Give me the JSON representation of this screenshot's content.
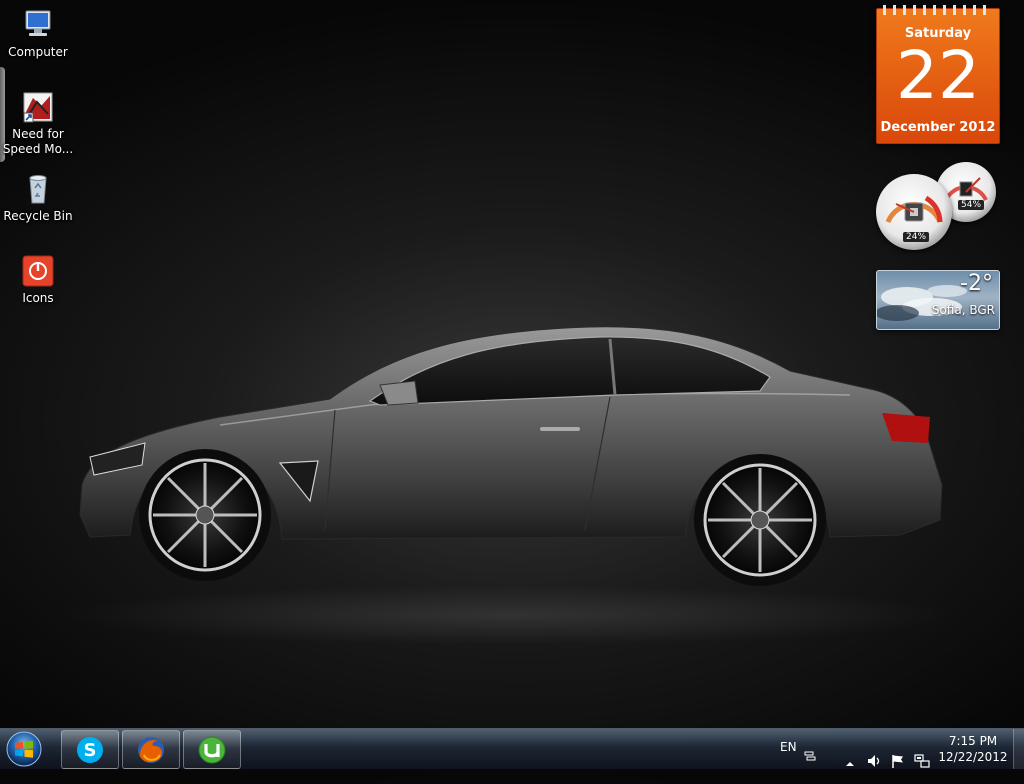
{
  "desktop": {
    "icons": [
      {
        "label": "Computer"
      },
      {
        "label": "Need for Speed Mo..."
      },
      {
        "label": "Recycle Bin"
      },
      {
        "label": "Icons"
      }
    ]
  },
  "gadgets": {
    "calendar": {
      "weekday": "Saturday",
      "day": "22",
      "month_year": "December 2012"
    },
    "cpu_meter": {
      "cpu_percent": "24%",
      "memory_percent": "54%"
    },
    "weather": {
      "temperature": "-2°",
      "location": "Sofia, BGR"
    }
  },
  "taskbar": {
    "pinned": [
      {
        "name": "Skype",
        "color": "#00aff0"
      },
      {
        "name": "Firefox",
        "color": "#e66000"
      },
      {
        "name": "uTorrent",
        "color": "#4bb43a"
      }
    ],
    "language": "EN",
    "clock": {
      "time": "7:15 PM",
      "date": "12/22/2012"
    }
  },
  "colors": {
    "calendar_orange": "#e85d12",
    "taskbar": "#1e2838"
  }
}
